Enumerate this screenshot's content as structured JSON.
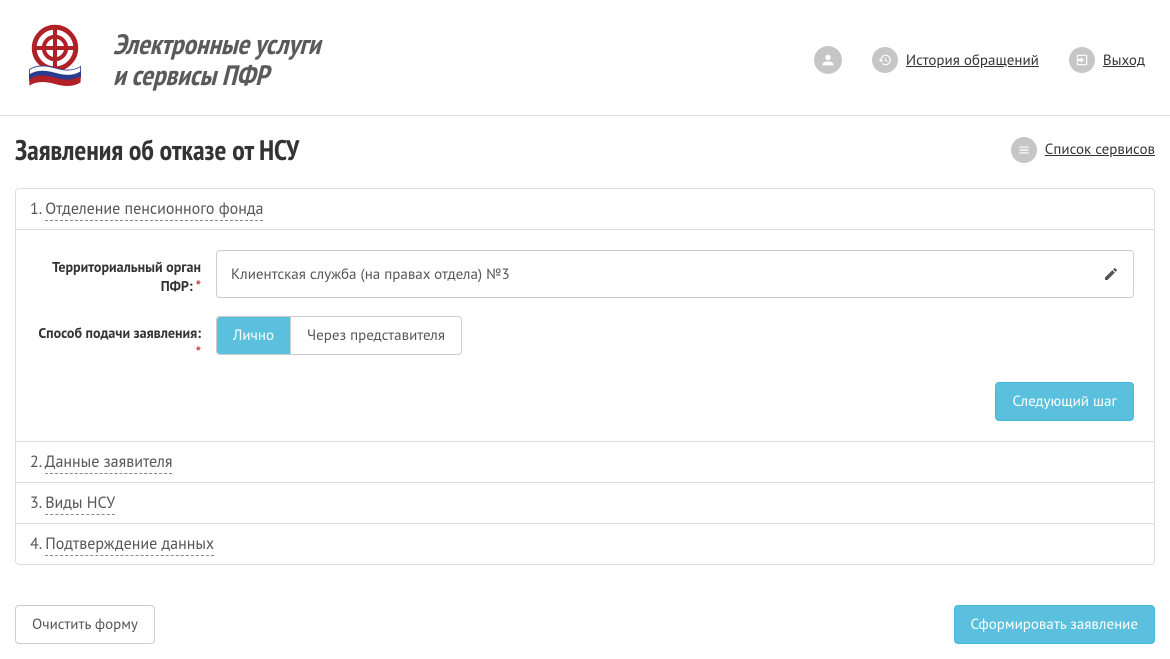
{
  "header": {
    "site_title_line1": "Электронные услуги",
    "site_title_line2": "и сервисы ПФР",
    "history_label": "История обращений",
    "logout_label": "Выход"
  },
  "page": {
    "title": "Заявления об отказе от НСУ",
    "services_link": "Список сервисов"
  },
  "steps": {
    "s1": {
      "num": "1.",
      "title": "Отделение пенсионного фонда"
    },
    "s2": {
      "num": "2.",
      "title": "Данные заявителя"
    },
    "s3": {
      "num": "3.",
      "title": "Виды НСУ"
    },
    "s4": {
      "num": "4.",
      "title": "Подтверждение данных"
    }
  },
  "form": {
    "territory_label": "Территориальный орган ПФР:",
    "territory_value": "Клиентская служба (на правах отдела) №3",
    "method_label": "Способ подачи заявления:",
    "method_options": {
      "self": "Лично",
      "rep": "Через представителя"
    },
    "next_step": "Следующий шаг"
  },
  "footer": {
    "clear": "Очистить форму",
    "submit": "Сформировать заявление"
  },
  "colors": {
    "accent": "#5bc0de",
    "danger": "#d43f3a"
  }
}
